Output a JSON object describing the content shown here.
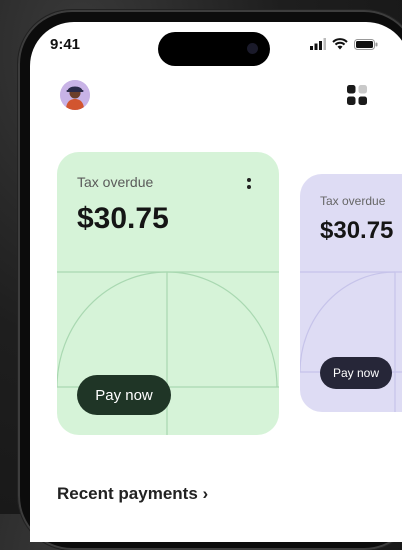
{
  "status_bar": {
    "time": "9:41"
  },
  "cards": [
    {
      "label": "Tax overdue",
      "amount": "$30.75",
      "button": "Pay now",
      "color": "#d6f3d8"
    },
    {
      "label": "Tax overdue",
      "amount": "$30.75",
      "button": "Pay now",
      "color": "#dedcf4"
    }
  ],
  "recent_payments": {
    "label": "Recent payments",
    "chevron": "›"
  },
  "icons": {
    "status": [
      "signal-icon",
      "wifi-icon",
      "battery-icon"
    ],
    "header": [
      "avatar",
      "grid-icon"
    ],
    "card": [
      "more-vertical-icon"
    ]
  }
}
